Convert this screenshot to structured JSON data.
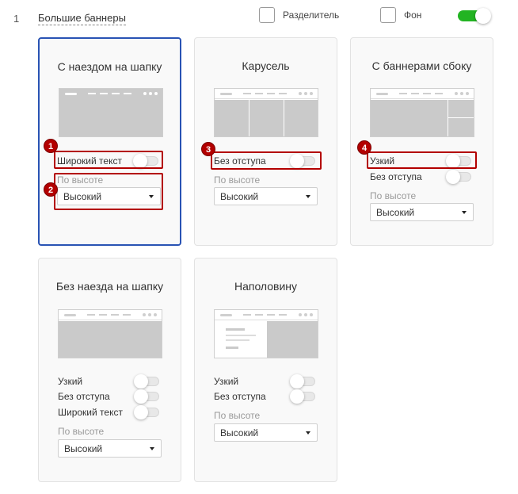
{
  "section": {
    "number": "1",
    "title": "Большие баннеры"
  },
  "header_options": {
    "divider_label": "Разделитель",
    "background_label": "Фон",
    "enabled": true
  },
  "colors": {
    "accent_green": "#22b422",
    "selected_border": "#2953b4",
    "annotation_red": "#b30000"
  },
  "cards": [
    {
      "title": "С наездом на шапку",
      "selected": true,
      "options": [
        "Широкий текст"
      ],
      "height_label": "По высоте",
      "height_value": "Высокий"
    },
    {
      "title": "Карусель",
      "selected": false,
      "options": [
        "Без отступа"
      ],
      "height_label": "По высоте",
      "height_value": "Высокий"
    },
    {
      "title": "С баннерами сбоку",
      "selected": false,
      "options": [
        "Узкий",
        "Без отступа"
      ],
      "height_label": "По высоте",
      "height_value": "Высокий"
    },
    {
      "title": "Без наезда на шапку",
      "selected": false,
      "options": [
        "Узкий",
        "Без отступа",
        "Широкий текст"
      ],
      "height_label": "По высоте",
      "height_value": "Высокий"
    },
    {
      "title": "Наполовину",
      "selected": false,
      "options": [
        "Узкий",
        "Без отступа"
      ],
      "height_label": "По высоте",
      "height_value": "Высокий"
    }
  ],
  "annotations": [
    "1",
    "2",
    "3",
    "4"
  ]
}
